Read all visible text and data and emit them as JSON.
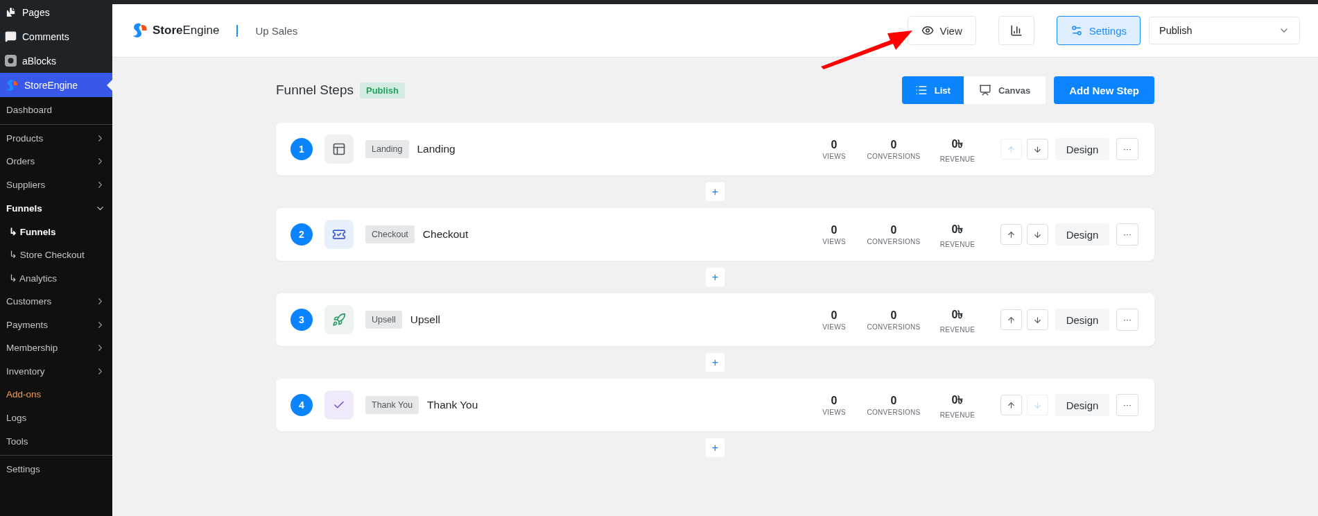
{
  "sidebar": {
    "top_items": [
      {
        "label": "Pages",
        "kind": "pages",
        "selected": false
      },
      {
        "label": "Comments",
        "kind": "comments",
        "selected": false
      },
      {
        "label": "aBlocks",
        "kind": "ablocks",
        "selected": false
      },
      {
        "label": "StoreEngine",
        "kind": "storeengine",
        "selected": true
      }
    ],
    "menu": [
      {
        "label": "Dashboard",
        "selected": false,
        "divider_after": true
      },
      {
        "label": "Products",
        "selected": false,
        "expanded": false
      },
      {
        "label": "Orders",
        "selected": false,
        "expanded": false
      },
      {
        "label": "Suppliers",
        "selected": false,
        "expanded": false
      },
      {
        "label": "Funnels",
        "selected": true,
        "expanded": true,
        "children": [
          {
            "label": "↳ Funnels",
            "selected": true
          },
          {
            "label": "↳ Store Checkout",
            "selected": false
          },
          {
            "label": "↳ Analytics",
            "selected": false
          }
        ]
      },
      {
        "label": "Customers",
        "selected": false,
        "expanded": false
      },
      {
        "label": "Payments",
        "selected": false,
        "expanded": false
      },
      {
        "label": "Membership",
        "selected": false,
        "expanded": false
      },
      {
        "label": "Inventory",
        "selected": false,
        "expanded": false
      },
      {
        "label": "Add-ons",
        "selected": false,
        "color": "#f0a04b"
      },
      {
        "label": "Logs",
        "selected": false
      },
      {
        "label": "Tools",
        "selected": false,
        "divider_after": true
      },
      {
        "label": "Settings",
        "selected": false
      }
    ]
  },
  "header": {
    "brand_bold": "Store",
    "brand_rest": "Engine",
    "page": "Up Sales",
    "view": "View",
    "settings": "Settings",
    "status_select": "Publish"
  },
  "title": "Funnel Steps",
  "status_badge": "Publish",
  "view_toggle": [
    {
      "label": "List",
      "selected": true
    },
    {
      "label": "Canvas",
      "selected": false
    }
  ],
  "add_button": "Add New Step",
  "steps": [
    {
      "number": "1",
      "kind": "landing",
      "tag": "Landing",
      "name": "Landing",
      "views": "0",
      "conversions": "0",
      "revenue": "0৳",
      "views_label": "VIEWS",
      "conversions_label": "CONVERSIONS",
      "revenue_label": "REVENUE",
      "up_disabled": true,
      "down_disabled": false,
      "design": "Design",
      "more": "···",
      "add": "+"
    },
    {
      "number": "2",
      "kind": "checkout",
      "tag": "Checkout",
      "name": "Checkout",
      "views": "0",
      "conversions": "0",
      "revenue": "0৳",
      "views_label": "VIEWS",
      "conversions_label": "CONVERSIONS",
      "revenue_label": "REVENUE",
      "up_disabled": false,
      "down_disabled": false,
      "design": "Design",
      "more": "···",
      "add": "+"
    },
    {
      "number": "3",
      "kind": "upsell",
      "tag": "Upsell",
      "name": "Upsell",
      "views": "0",
      "conversions": "0",
      "revenue": "0৳",
      "views_label": "VIEWS",
      "conversions_label": "CONVERSIONS",
      "revenue_label": "REVENUE",
      "up_disabled": false,
      "down_disabled": false,
      "design": "Design",
      "more": "···",
      "add": "+"
    },
    {
      "number": "4",
      "kind": "thankyou",
      "tag": "Thank You",
      "name": "Thank You",
      "views": "0",
      "conversions": "0",
      "revenue": "0৳",
      "views_label": "VIEWS",
      "conversions_label": "CONVERSIONS",
      "revenue_label": "REVENUE",
      "up_disabled": false,
      "down_disabled": true,
      "design": "Design",
      "more": "···",
      "add": "+"
    }
  ]
}
